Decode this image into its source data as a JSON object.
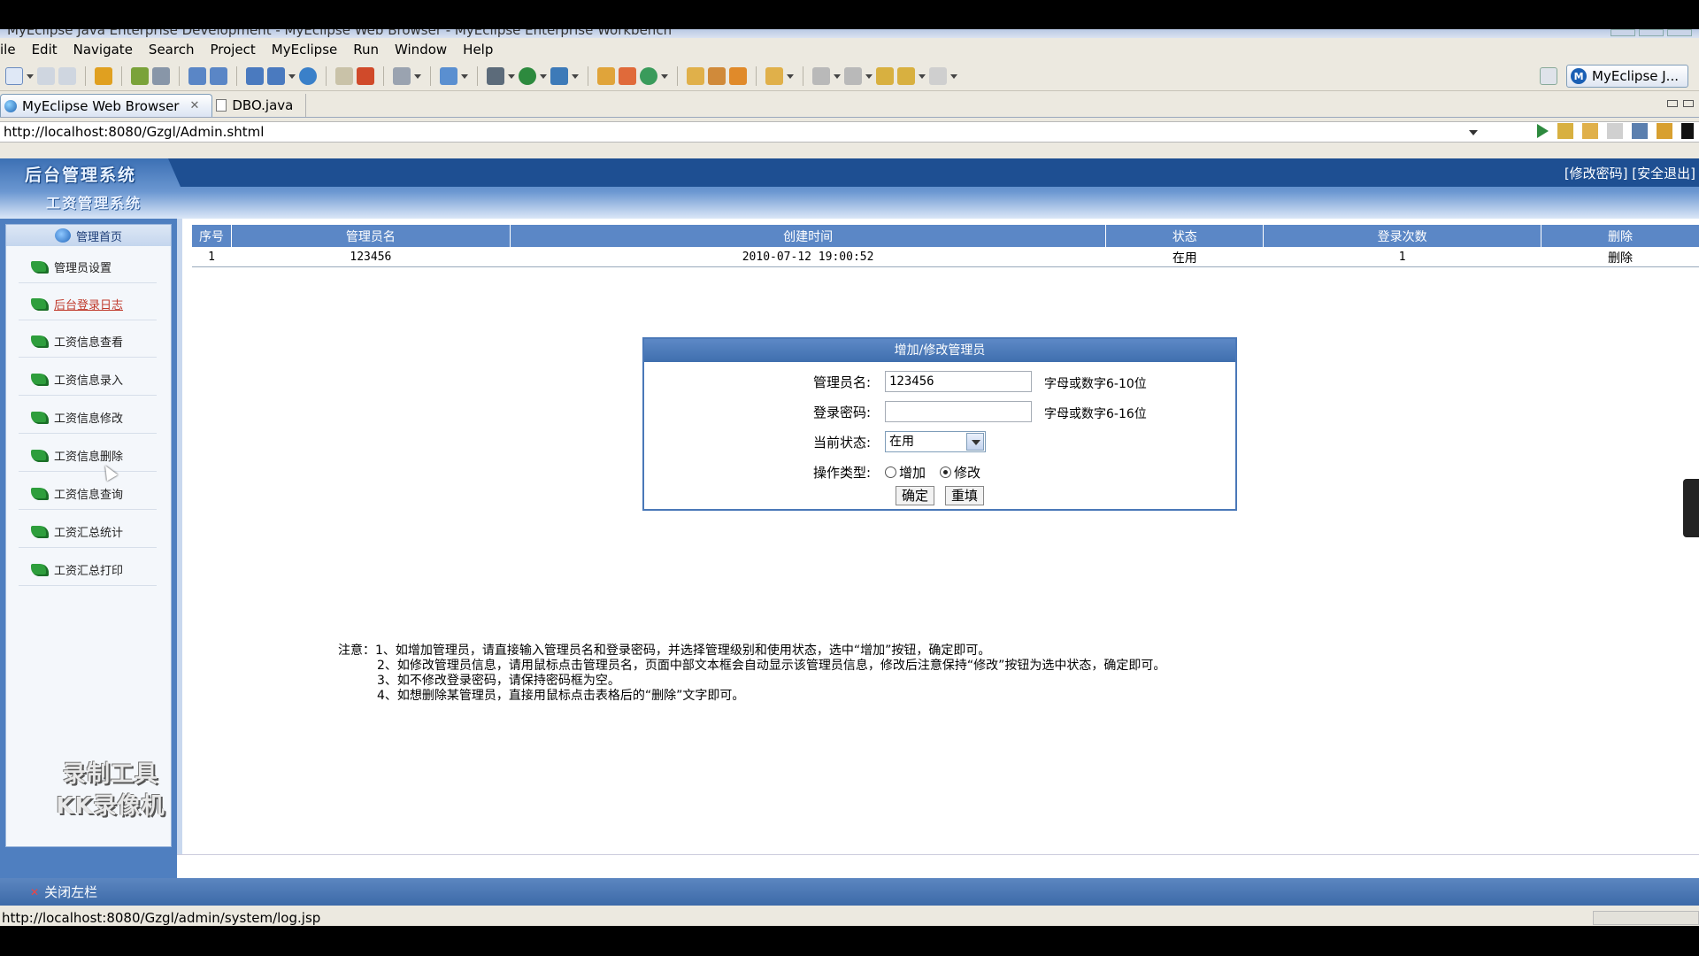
{
  "window": {
    "title": "MyEclipse Java Enterprise Development - MyEclipse Web Browser - MyEclipse Enterprise Workbench"
  },
  "menu": [
    "ile",
    "Edit",
    "Navigate",
    "Search",
    "Project",
    "MyEclipse",
    "Run",
    "Window",
    "Help"
  ],
  "perspective": {
    "label": "MyEclipse J..."
  },
  "tabs": [
    {
      "label": "MyEclipse Web Browser",
      "close": "✕"
    },
    {
      "label": "DBO.java"
    }
  ],
  "browser": {
    "url": "http://localhost:8080/Gzgl/Admin.shtml"
  },
  "app": {
    "logo": "后台管理系统",
    "subtitle": "工资管理系统",
    "header_links": "[修改密码] [安全退出]"
  },
  "sidebar": {
    "header": "管理首页",
    "items": [
      {
        "label": "管理员设置"
      },
      {
        "label": "后台登录日志"
      },
      {
        "label": "工资信息查看"
      },
      {
        "label": "工资信息录入"
      },
      {
        "label": "工资信息修改"
      },
      {
        "label": "工资信息删除"
      },
      {
        "label": "工资信息查询"
      },
      {
        "label": "工资汇总统计"
      },
      {
        "label": "工资汇总打印"
      }
    ],
    "watermark_line1": "录制工具",
    "watermark_line2": "KK录像机",
    "close_label": "关闭左栏"
  },
  "table": {
    "headers": [
      "序号",
      "管理员名",
      "创建时间",
      "状态",
      "登录次数",
      "删除"
    ],
    "rows": [
      [
        "1",
        "123456",
        "2010-07-12 19:00:52",
        "在用",
        "1",
        "删除"
      ]
    ]
  },
  "form": {
    "title": "增加/修改管理员",
    "username_label": "管理员名:",
    "username_value": "123456",
    "username_hint": "字母或数字6-10位",
    "password_label": "登录密码:",
    "password_value": "",
    "password_hint": "字母或数字6-16位",
    "status_label": "当前状态:",
    "status_value": "在用",
    "optype_label": "操作类型:",
    "optype_add": "增加",
    "optype_edit": "修改",
    "optype_selected": "修改",
    "submit": "确定",
    "reset": "重填"
  },
  "notes": [
    "注意：1、如增加管理员，请直接输入管理员名和登录密码，并选择管理级别和使用状态，选中“增加”按钮，确定即可。",
    "2、如修改管理员信息，请用鼠标点击管理员名，页面中部文本框会自动显示该管理员信息，修改后注意保持“修改”按钮为选中状态，确定即可。",
    "3、如不修改登录密码，请保持密码框为空。",
    "4、如想删除某管理员，直接用鼠标点击表格后的“删除”文字即可。"
  ],
  "statusbar": {
    "text": "http://localhost:8080/Gzgl/admin/system/log.jsp"
  }
}
